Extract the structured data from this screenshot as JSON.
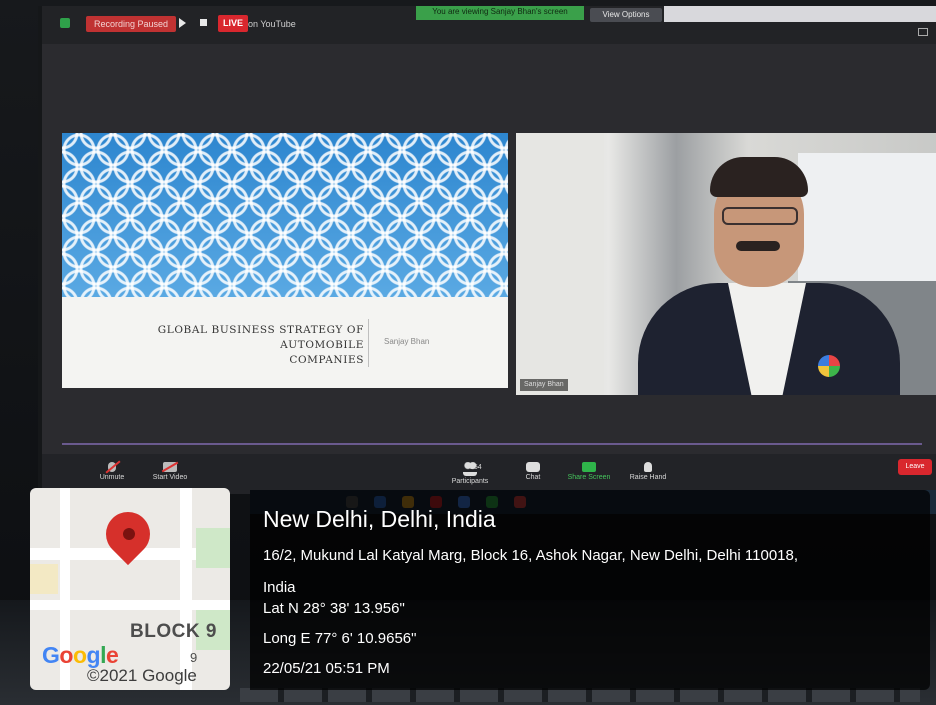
{
  "zoom": {
    "recording_status": "Recording Paused",
    "live_label": "LIVE",
    "live_destination": "on YouTube",
    "viewing_banner": "You are viewing Sanjay Bhan's screen",
    "view_options": "View Options",
    "slide": {
      "title_line1": "GLOBAL BUSINESS STRATEGY OF AUTOMOBILE",
      "title_line2": "COMPANIES",
      "presenter": "Sanjay Bhan"
    },
    "video": {
      "participant_name": "Sanjay Bhan"
    },
    "toolbar": {
      "unmute": "Unmute",
      "start_video": "Start Video",
      "participants": "Participants",
      "participant_count": "254",
      "chat": "Chat",
      "share_screen": "Share Screen",
      "raise_hand": "Raise Hand",
      "leave": "Leave"
    }
  },
  "map": {
    "block_label": "BLOCK 9",
    "block_number": "9",
    "copyright": "©2021 Google",
    "logo": [
      "G",
      "o",
      "o",
      "g",
      "l",
      "e"
    ]
  },
  "geotag": {
    "city": "New Delhi, Delhi, India",
    "address_line1": "16/2, Mukund Lal Katyal Marg, Block 16, Ashok Nagar, New Delhi, Delhi 110018,",
    "address_line2": "India",
    "latitude": "Lat N 28° 38' 13.956\"",
    "longitude": "Long E 77° 6' 10.9656\"",
    "datetime": "22/05/21 05:51 PM"
  },
  "colors": {
    "live_red": "#d9272e",
    "share_green": "#2fb44a",
    "pin_red": "#d6302b"
  }
}
